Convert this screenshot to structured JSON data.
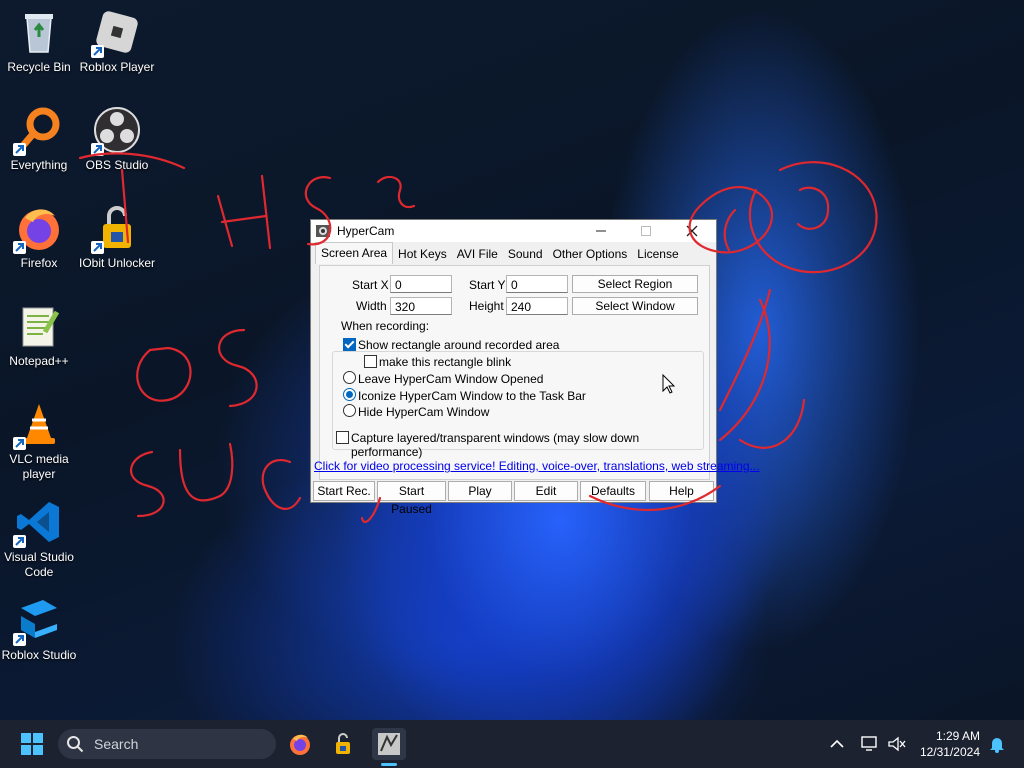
{
  "desktop": {
    "icons": [
      {
        "label": "Recycle Bin",
        "icon": "recycle-bin-icon"
      },
      {
        "label": "Roblox Player",
        "icon": "roblox-player-icon"
      },
      {
        "label": "Everything",
        "icon": "everything-search-icon"
      },
      {
        "label": "OBS Studio",
        "icon": "obs-studio-icon"
      },
      {
        "label": "Firefox",
        "icon": "firefox-icon"
      },
      {
        "label": "IObit Unlocker",
        "icon": "iobit-unlocker-icon"
      },
      {
        "label": "Notepad++",
        "icon": "notepad-plus-plus-icon"
      },
      {
        "label": "VLC media player",
        "icon": "vlc-icon"
      },
      {
        "label": "Visual Studio Code",
        "icon": "vscode-icon"
      },
      {
        "label": "Roblox Studio",
        "icon": "roblox-studio-icon"
      }
    ]
  },
  "window": {
    "title": "HyperCam",
    "tabs": [
      "Screen Area",
      "Hot Keys",
      "AVI File",
      "Sound",
      "Other Options",
      "License"
    ],
    "fields": {
      "start_x_label": "Start X",
      "start_x": "0",
      "start_y_label": "Start Y",
      "start_y": "0",
      "width_label": "Width",
      "width": "320",
      "height_label": "Height",
      "height": "240"
    },
    "buttons": {
      "select_region": "Select Region",
      "select_window": "Select Window"
    },
    "when_recording": {
      "label": "When recording:",
      "show_rectangle": "Show rectangle around recorded area",
      "rectangle_blink": "make this rectangle blink",
      "leave_opened": "Leave HyperCam Window Opened",
      "iconize": "Iconize HyperCam Window to the Task Bar",
      "hide": "Hide HyperCam Window"
    },
    "capture_layered": "Capture layered/transparent windows (may slow down performance)",
    "link": "Click for video processing service! Editing, voice-over, translations, web streaming...",
    "bottom_buttons": [
      "Start Rec.",
      "Start Paused",
      "Play",
      "Edit",
      "Defaults",
      "Help"
    ]
  },
  "taskbar": {
    "search_placeholder": "Search",
    "time": "1:29 AM",
    "date": "12/31/2024"
  },
  "colors": {
    "accent": "#0067c0",
    "scribble": "#e0282f",
    "link": "#0000ee"
  }
}
